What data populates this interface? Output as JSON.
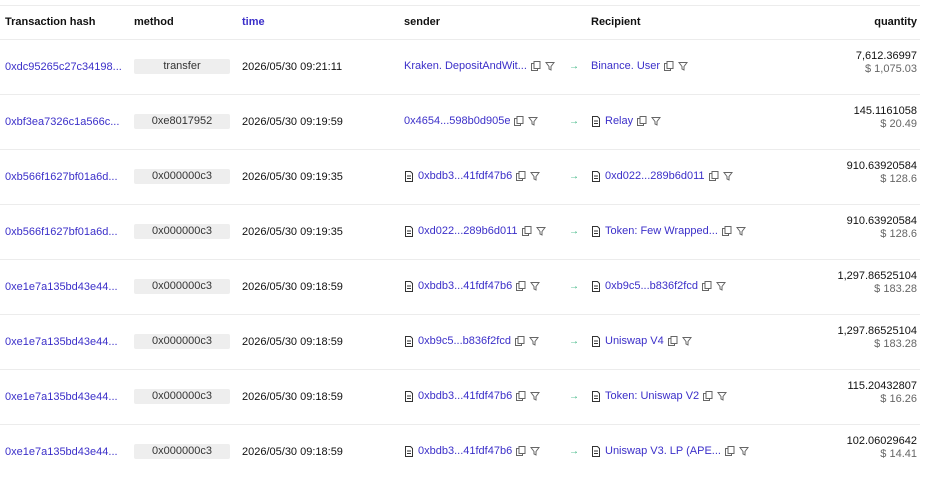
{
  "headers": {
    "hash": "Transaction hash",
    "method": "method",
    "time": "time",
    "sender": "sender",
    "recipient": "Recipient",
    "quantity": "quantity"
  },
  "colors": {
    "link": "#3b2fc9",
    "arrow": "#36b37e",
    "method_bg": "#eeeeee"
  },
  "rows": [
    {
      "hash": "0xdc95265c27c34198...",
      "method": "transfer",
      "time": "2026/05/30 09:21:11",
      "sender": {
        "text": "Kraken. DepositAndWit...",
        "doc": false
      },
      "recipient": {
        "text": "Binance. User",
        "doc": false
      },
      "amount": "7,612.36997",
      "usd": "$ 1,075.03"
    },
    {
      "hash": "0xbf3ea7326c1a566c...",
      "method": "0xe8017952",
      "time": "2026/05/30 09:19:59",
      "sender": {
        "text": "0x4654...598b0d905e",
        "doc": false
      },
      "recipient": {
        "text": "Relay",
        "doc": true
      },
      "amount": "145.1161058",
      "usd": "$ 20.49"
    },
    {
      "hash": "0xb566f1627bf01a6d...",
      "method": "0x000000c3",
      "time": "2026/05/30 09:19:35",
      "sender": {
        "text": "0xbdb3...41fdf47b6",
        "doc": true
      },
      "recipient": {
        "text": "0xd022...289b6d011",
        "doc": true
      },
      "amount": "910.63920584",
      "usd": "$ 128.6"
    },
    {
      "hash": "0xb566f1627bf01a6d...",
      "method": "0x000000c3",
      "time": "2026/05/30 09:19:35",
      "sender": {
        "text": "0xd022...289b6d011",
        "doc": true
      },
      "recipient": {
        "text": "Token: Few Wrapped...",
        "doc": true
      },
      "amount": "910.63920584",
      "usd": "$ 128.6"
    },
    {
      "hash": "0xe1e7a135bd43e44...",
      "method": "0x000000c3",
      "time": "2026/05/30 09:18:59",
      "sender": {
        "text": "0xbdb3...41fdf47b6",
        "doc": true
      },
      "recipient": {
        "text": "0xb9c5...b836f2fcd",
        "doc": true
      },
      "amount": "1,297.86525104",
      "usd": "$ 183.28"
    },
    {
      "hash": "0xe1e7a135bd43e44...",
      "method": "0x000000c3",
      "time": "2026/05/30 09:18:59",
      "sender": {
        "text": "0xb9c5...b836f2fcd",
        "doc": true
      },
      "recipient": {
        "text": "Uniswap V4",
        "doc": true
      },
      "amount": "1,297.86525104",
      "usd": "$ 183.28"
    },
    {
      "hash": "0xe1e7a135bd43e44...",
      "method": "0x000000c3",
      "time": "2026/05/30 09:18:59",
      "sender": {
        "text": "0xbdb3...41fdf47b6",
        "doc": true
      },
      "recipient": {
        "text": "Token: Uniswap V2",
        "doc": true
      },
      "amount": "115.20432807",
      "usd": "$ 16.26"
    },
    {
      "hash": "0xe1e7a135bd43e44...",
      "method": "0x000000c3",
      "time": "2026/05/30 09:18:59",
      "sender": {
        "text": "0xbdb3...41fdf47b6",
        "doc": true
      },
      "recipient": {
        "text": "Uniswap V3. LP (APE...",
        "doc": true
      },
      "amount": "102.06029642",
      "usd": "$ 14.41"
    }
  ]
}
